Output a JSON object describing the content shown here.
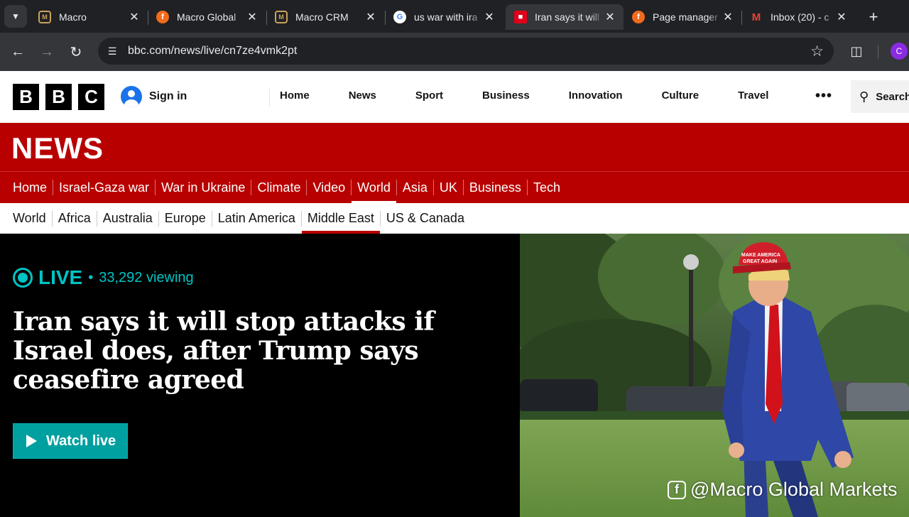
{
  "browser": {
    "tabs": [
      {
        "title": "Macro",
        "favicon": "macro-logo-icon",
        "active": false
      },
      {
        "title": "Macro Global",
        "favicon": "facebook-icon",
        "active": false
      },
      {
        "title": "Macro CRM",
        "favicon": "macro-logo-icon",
        "active": false
      },
      {
        "title": "us war with ira",
        "favicon": "google-icon",
        "active": false
      },
      {
        "title": "Iran says it will",
        "favicon": "bbc-icon",
        "active": true
      },
      {
        "title": "Page manager",
        "favicon": "facebook-icon",
        "active": false
      },
      {
        "title": "Inbox (20) - c",
        "favicon": "gmail-icon",
        "active": false
      }
    ],
    "url": "bbc.com/news/live/cn7ze4vmk2pt",
    "profile_initial": "C",
    "profile_color": "#8a2be2"
  },
  "masthead": {
    "logo_letters": [
      "B",
      "B",
      "C"
    ],
    "signin_label": "Sign in",
    "nav": [
      "Home",
      "News",
      "Sport",
      "Business",
      "Innovation",
      "Culture",
      "Travel"
    ],
    "search_label": "Search"
  },
  "news": {
    "title": "NEWS",
    "brand_color": "#b80000",
    "nav": [
      "Home",
      "Israel-Gaza war",
      "War in Ukraine",
      "Climate",
      "Video",
      "World",
      "Asia",
      "UK",
      "Business",
      "Tech"
    ],
    "nav_active": "World",
    "subnav": [
      "World",
      "Africa",
      "Australia",
      "Europe",
      "Latin America",
      "Middle East",
      "US & Canada"
    ],
    "subnav_active": "Middle East"
  },
  "live": {
    "label": "LIVE",
    "viewing": "33,292 viewing",
    "accent_color": "#00c4c4",
    "headline": "Iran says it will stop attacks if Israel does, after Trump says ceasefire agreed",
    "watch_label": "Watch live"
  },
  "watermark": {
    "text": "@Macro Global Markets",
    "cap_text_line1": "MAKE AMERICA",
    "cap_text_line2": "GREAT AGAIN"
  }
}
